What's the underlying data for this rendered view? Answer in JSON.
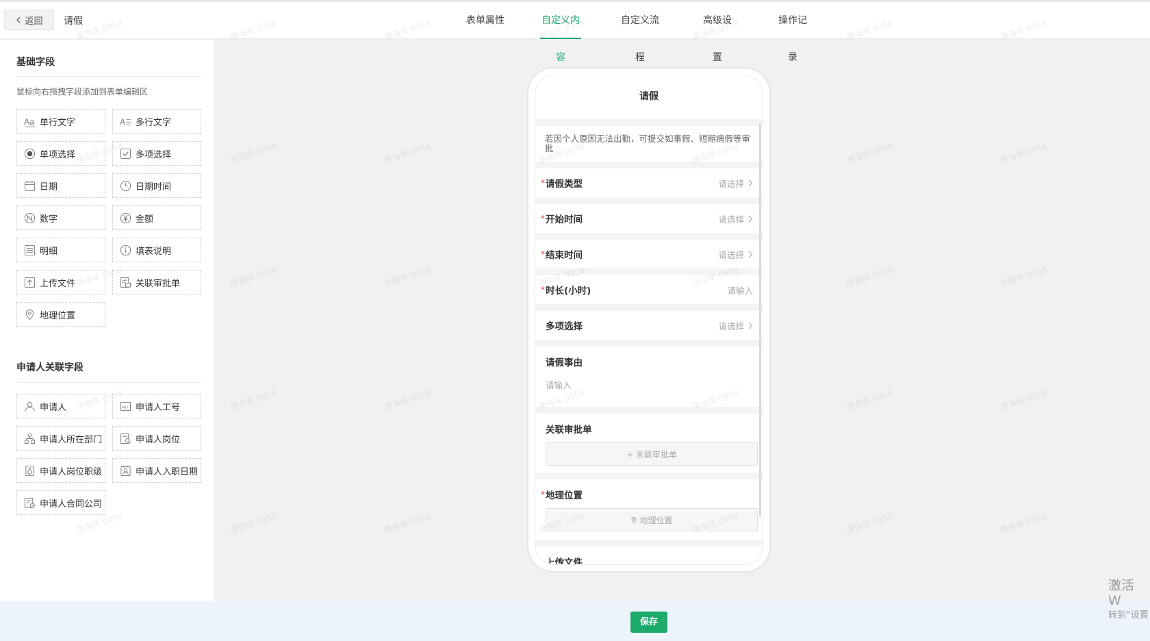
{
  "header": {
    "back_label": "返回",
    "title": "请假",
    "tabs": [
      "表单属性",
      "自定义内容",
      "自定义流程",
      "高级设置",
      "操作记录"
    ],
    "active_tab": 1
  },
  "sidebar": {
    "basic_title": "基础字段",
    "hint": "鼠标向右拖拽字段添加到表单编辑区",
    "basic_fields": [
      {
        "label": "单行文字",
        "icon": "text-icon"
      },
      {
        "label": "多行文字",
        "icon": "multiline-text-icon"
      },
      {
        "label": "单项选择",
        "icon": "radio-icon"
      },
      {
        "label": "多项选择",
        "icon": "checkbox-icon"
      },
      {
        "label": "日期",
        "icon": "calendar-icon"
      },
      {
        "label": "日期时间",
        "icon": "clock-icon"
      },
      {
        "label": "数字",
        "icon": "number-icon"
      },
      {
        "label": "金额",
        "icon": "currency-icon"
      },
      {
        "label": "明细",
        "icon": "list-icon"
      },
      {
        "label": "填表说明",
        "icon": "info-icon"
      },
      {
        "label": "上传文件",
        "icon": "upload-icon"
      },
      {
        "label": "关联审批单",
        "icon": "linked-form-icon"
      },
      {
        "label": "地理位置",
        "icon": "location-icon"
      }
    ],
    "applicant_title": "申请人关联字段",
    "applicant_fields": [
      {
        "label": "申请人",
        "icon": "user-icon"
      },
      {
        "label": "申请人工号",
        "icon": "id-badge-icon"
      },
      {
        "label": "申请人所在部门",
        "icon": "org-icon"
      },
      {
        "label": "申请人岗位",
        "icon": "position-icon"
      },
      {
        "label": "申请人岗位职级",
        "icon": "rank-icon"
      },
      {
        "label": "申请人入职日期",
        "icon": "entry-date-icon"
      },
      {
        "label": "申请人合同公司",
        "icon": "company-icon"
      }
    ]
  },
  "form": {
    "title": "请假",
    "description": "若因个人原因无法出勤，可提交如事假、短期病假等审批",
    "rows": [
      {
        "label": "请假类型",
        "required": true,
        "placeholder": "请选择",
        "arrow": true
      },
      {
        "label": "开始时间",
        "required": true,
        "placeholder": "请选择",
        "arrow": true
      },
      {
        "label": "结束时间",
        "required": true,
        "placeholder": "请选择",
        "arrow": true
      },
      {
        "label": "时长(小时)",
        "required": true,
        "placeholder": "请输入",
        "arrow": false
      },
      {
        "label": "多项选择",
        "required": false,
        "placeholder": "请选择",
        "arrow": true
      }
    ],
    "reason_label": "请假事由",
    "reason_placeholder": "请输入",
    "linked_label": "关联审批单",
    "linked_button": "+ 关联审批单",
    "location_label": "地理位置",
    "location_button": "地理位置",
    "upload_label": "上传文件"
  },
  "footer": {
    "save_label": "保存"
  },
  "system": {
    "activate_line1": "激活 W",
    "activate_line2": "转到“设置"
  },
  "watermark": "唐海荣 0958",
  "colors": {
    "accent": "#1aaa6b",
    "required": "#e54545"
  }
}
